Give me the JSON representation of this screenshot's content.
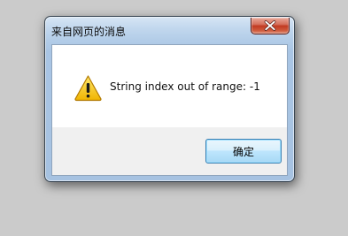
{
  "dialog": {
    "title": "来自网页的消息",
    "message": "String index out of range: -1",
    "ok_label": "确定",
    "icon": "warning-icon"
  },
  "window_controls": {
    "close_icon": "close-icon"
  },
  "colors": {
    "close_button": "#c13a22",
    "warning": "#f7c20f",
    "ok_border": "#3c7fb1"
  }
}
